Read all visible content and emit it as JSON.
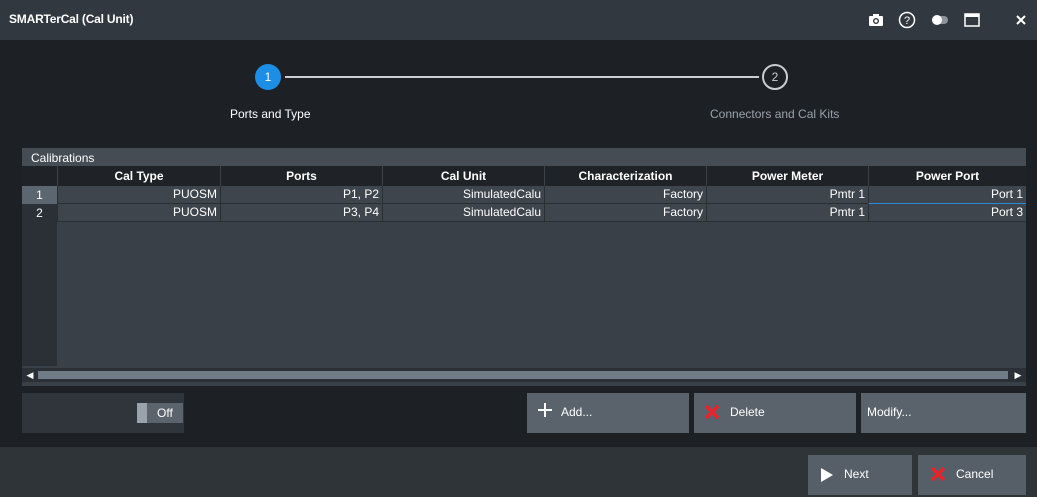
{
  "window": {
    "title": "SMARTerCal (Cal Unit)",
    "icons": [
      "camera-icon",
      "help-icon",
      "toggle-icon",
      "maximize-icon",
      "close-icon"
    ]
  },
  "wizard": {
    "steps": [
      {
        "number": "1",
        "label": "Ports and Type",
        "active": true
      },
      {
        "number": "2",
        "label": "Connectors and Cal Kits",
        "active": false
      }
    ]
  },
  "calibrations": {
    "title": "Calibrations",
    "columns": [
      "Cal Type",
      "Ports",
      "Cal Unit",
      "Characterization",
      "Power Meter",
      "Power Port"
    ],
    "rows": [
      {
        "index": "1",
        "cells": [
          "PUOSM",
          "P1, P2",
          "SimulatedCalu",
          "Factory",
          "Pmtr 1",
          "Port 1"
        ]
      },
      {
        "index": "2",
        "cells": [
          "PUOSM",
          "P3, P4",
          "SimulatedCalu",
          "Factory",
          "Pmtr 1",
          "Port 3"
        ]
      }
    ]
  },
  "toggle": {
    "state": "Off"
  },
  "actions": {
    "add": "Add...",
    "delete": "Delete",
    "modify": "Modify..."
  },
  "footer": {
    "next": "Next",
    "cancel": "Cancel"
  },
  "colors": {
    "accent": "#1c8ee6",
    "delete_icon": "#e8232a"
  }
}
